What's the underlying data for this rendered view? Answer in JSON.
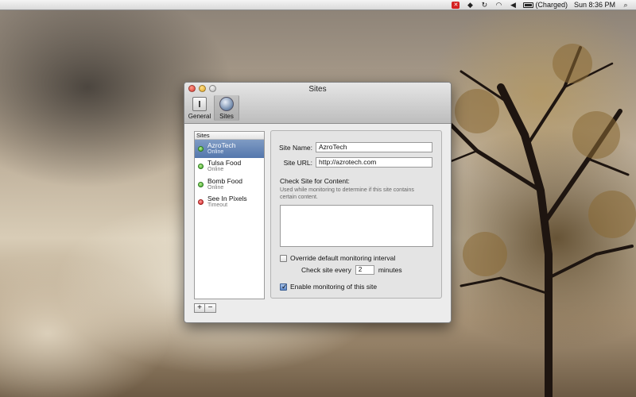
{
  "menubar": {
    "battery_status": "(Charged)",
    "clock": "Sun 8:36 PM"
  },
  "window": {
    "title": "Sites",
    "toolbar": [
      {
        "label": "General"
      },
      {
        "label": "Sites"
      }
    ]
  },
  "sidebar": {
    "header": "Sites",
    "sites": [
      {
        "name": "AzroTech",
        "status": "Online",
        "color": "#3ca12a"
      },
      {
        "name": "Tulsa Food",
        "status": "Online",
        "color": "#3ca12a"
      },
      {
        "name": "Bomb Food",
        "status": "Online",
        "color": "#3ca12a"
      },
      {
        "name": "See In Pixels",
        "status": "Timeout",
        "color": "#d42020"
      }
    ],
    "add_label": "+",
    "remove_label": "−"
  },
  "form": {
    "site_name_label": "Site Name:",
    "site_name_value": "AzroTech",
    "site_url_label": "Site URL:",
    "site_url_value": "http://azrotech.com",
    "check_content_title": "Check Site for Content:",
    "check_content_help": "Used while monitoring to determine if this site contains certain content.",
    "override_label": "Override default monitoring interval",
    "check_every_label": "Check site every",
    "check_every_value": "2",
    "minutes_label": "minutes",
    "enable_label": "Enable monitoring of this site"
  }
}
